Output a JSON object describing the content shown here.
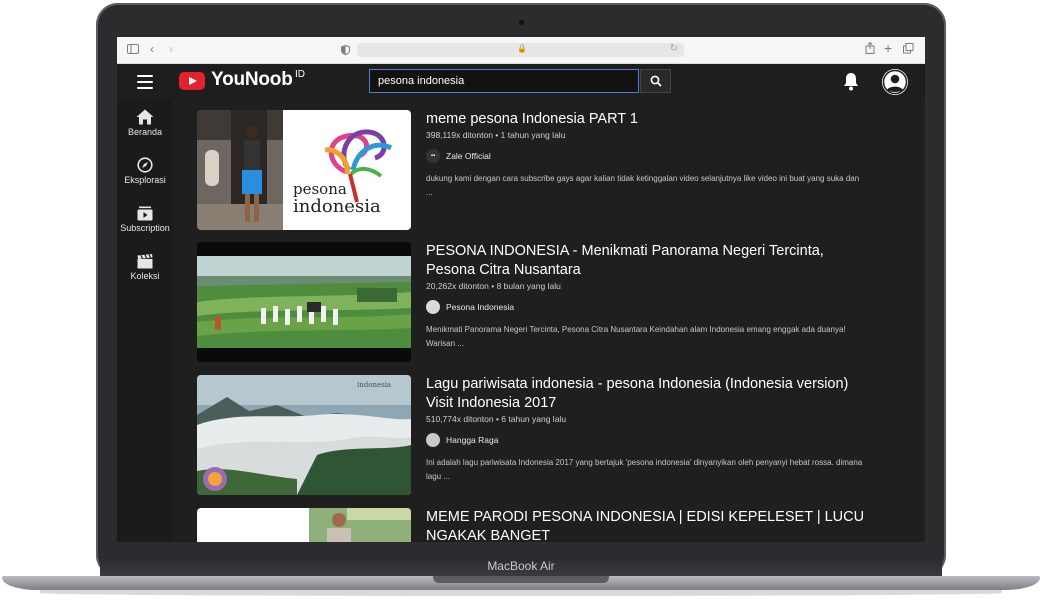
{
  "device": {
    "label": "MacBook Air"
  },
  "app": {
    "name": "YouNoob",
    "superscript": "ID"
  },
  "search": {
    "value": "pesona indonesia"
  },
  "sidebar": {
    "items": [
      {
        "label": "Beranda",
        "icon": "home-icon"
      },
      {
        "label": "Eksplorasi",
        "icon": "compass-icon"
      },
      {
        "label": "Subscription",
        "icon": "subscription-icon"
      },
      {
        "label": "Koleksi",
        "icon": "clapperboard-icon"
      }
    ]
  },
  "results": [
    {
      "title": "meme pesona Indonesia PART 1",
      "views": "398,119x ditonton",
      "age": "1 tahun yang lalu",
      "channel": "Zale Official",
      "description": "dukung kami dengan cara subscribe gays agar kalian tidak ketinggalan video selanjutnya like video ini buat yang suka dan ..."
    },
    {
      "title": "PESONA INDONESIA - Menikmati Panorama Negeri Tercinta, Pesona Citra Nusantara",
      "views": "20,262x ditonton",
      "age": "8 bulan yang lalu",
      "channel": "Pesona Indonesia",
      "description": "Menikmati Panorama Negeri Tercinta, Pesona Citra Nusantara Keindahan alam Indonesia emang enggak ada duanya! Warisan ..."
    },
    {
      "title": "Lagu pariwisata indonesia - pesona Indonesia (Indonesia version) Visit Indonesia 2017",
      "views": "510,774x ditonton",
      "age": "6 tahun yang lalu",
      "channel": "Hangga Raga",
      "description": "Ini adalah lagu pariwisata Indonesia 2017 yang bertajuk 'pesona indonesia' dinyanyikan oleh penyanyi hebat rossa. dimana lagu ..."
    },
    {
      "title": "MEME PARODI PESONA INDONESIA | EDISI KEPELESET | LUCU NGAKAK BANGET"
    }
  ],
  "thumbnail_text": {
    "pesona": "pesona",
    "indonesia": "indonesia"
  },
  "colors": {
    "brand": "#e2232b",
    "background": "#1f1f1f",
    "search_border": "#4f7fd9"
  }
}
